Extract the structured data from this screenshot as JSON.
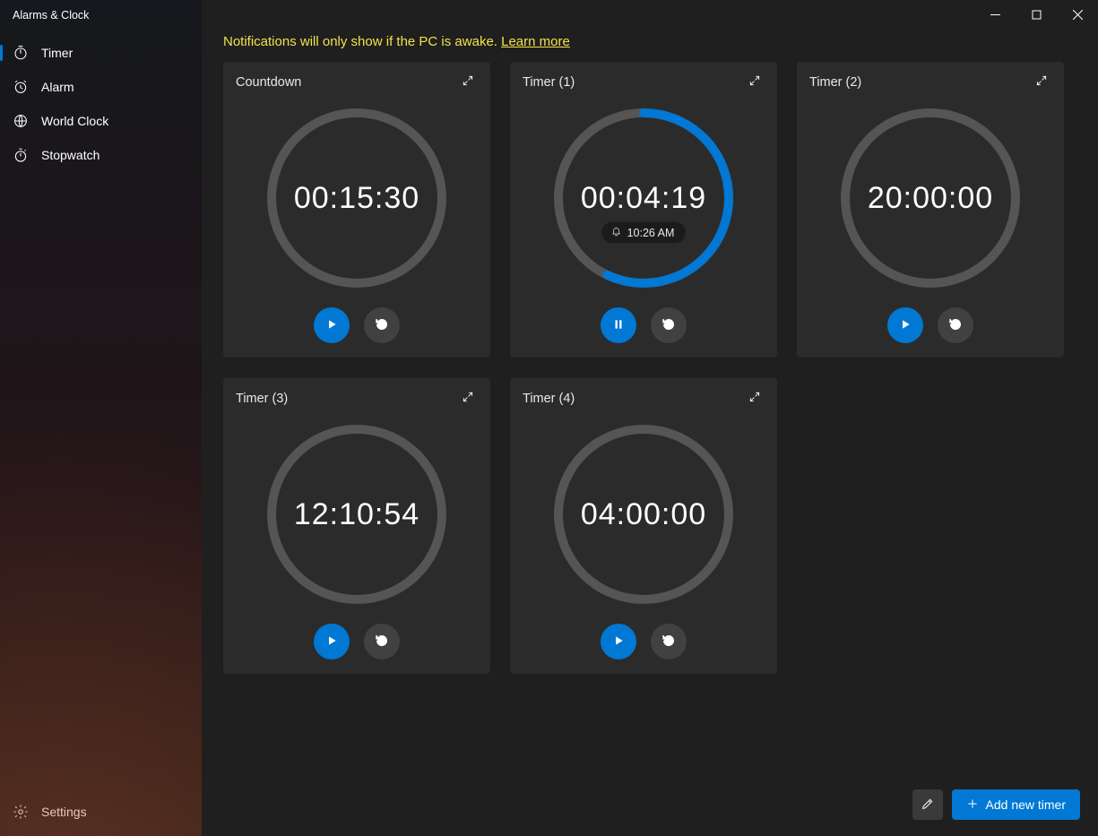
{
  "app_title": "Alarms & Clock",
  "sidebar": {
    "items": [
      {
        "label": "Timer",
        "icon": "timer",
        "active": true
      },
      {
        "label": "Alarm",
        "icon": "alarm",
        "active": false
      },
      {
        "label": "World Clock",
        "icon": "worldclock",
        "active": false
      },
      {
        "label": "Stopwatch",
        "icon": "stopwatch",
        "active": false
      }
    ],
    "settings_label": "Settings"
  },
  "notice": {
    "text": "Notifications will only show if the PC is awake. ",
    "link": "Learn more"
  },
  "timers": [
    {
      "name": "Countdown",
      "time": "00:15:30",
      "progress": 0,
      "state": "ready",
      "eta": null
    },
    {
      "name": "Timer (1)",
      "time": "00:04:19",
      "progress": 0.57,
      "state": "running",
      "eta": "10:26 AM"
    },
    {
      "name": "Timer (2)",
      "time": "20:00:00",
      "progress": 0,
      "state": "ready",
      "eta": null
    },
    {
      "name": "Timer (3)",
      "time": "12:10:54",
      "progress": 0,
      "state": "ready",
      "eta": null
    },
    {
      "name": "Timer (4)",
      "time": "04:00:00",
      "progress": 0,
      "state": "ready",
      "eta": null
    }
  ],
  "footer": {
    "add_label": "Add new timer"
  },
  "colors": {
    "accent": "#0078d4",
    "bg_main": "#1f1f1f",
    "bg_card": "#2b2b2b",
    "notice_text": "#f2e24b"
  }
}
